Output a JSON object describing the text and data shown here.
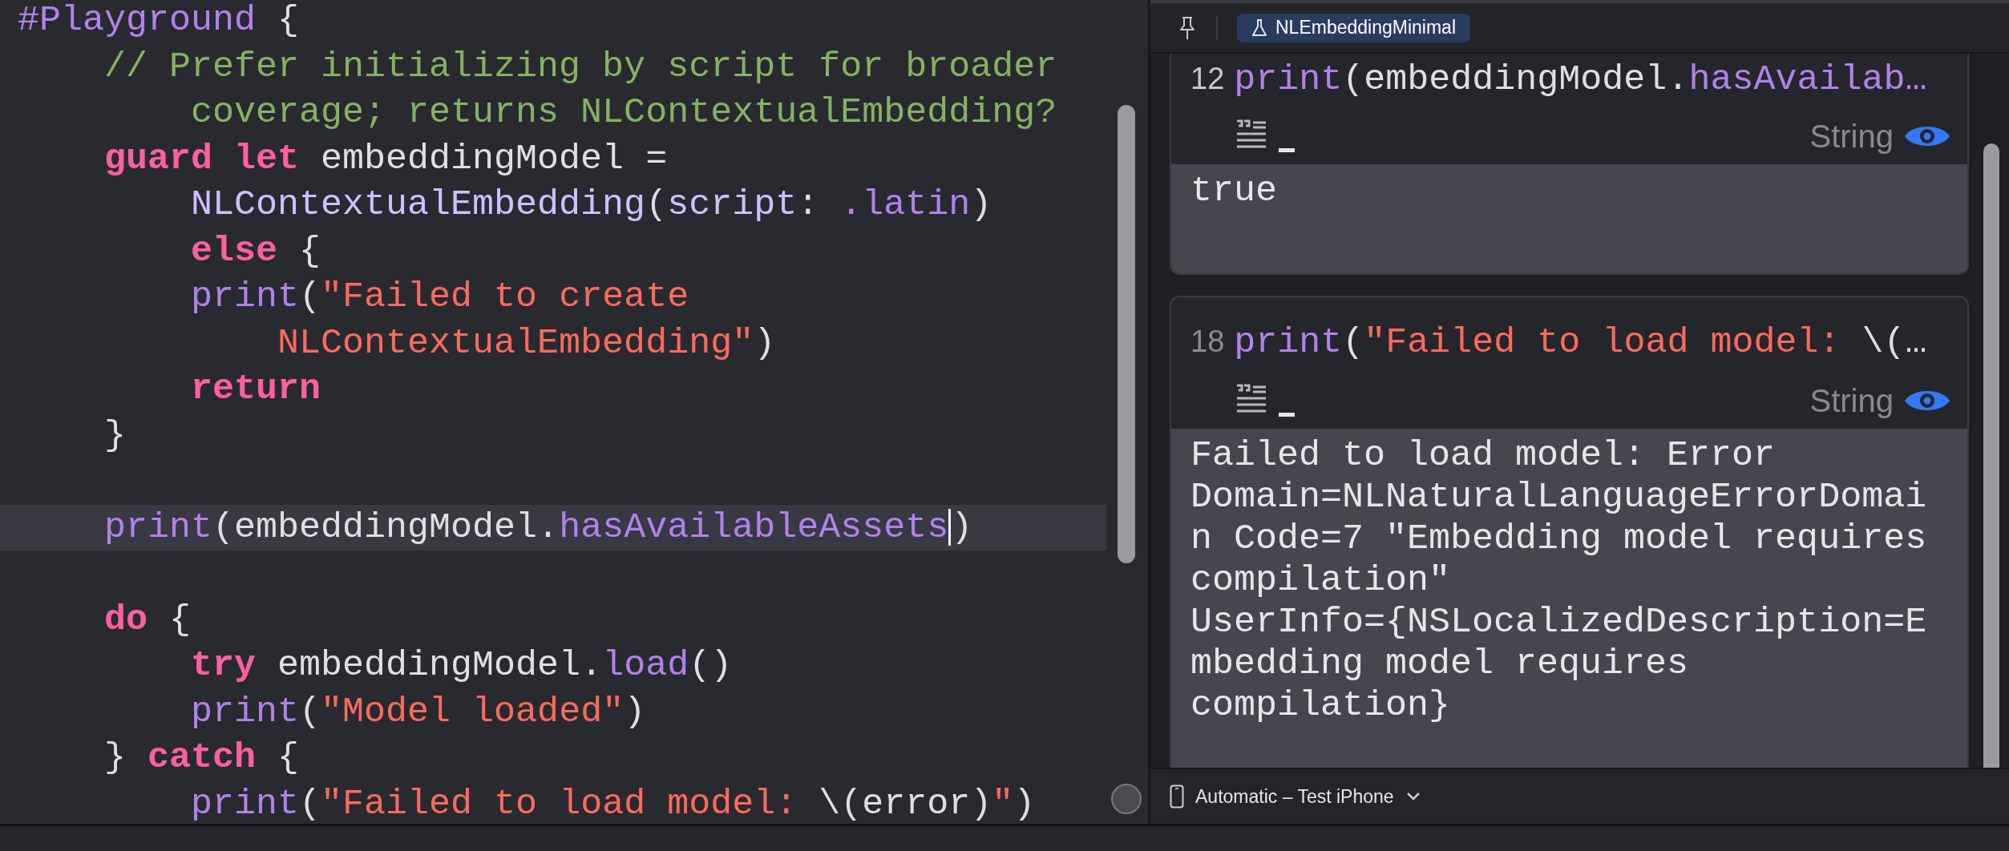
{
  "editor": {
    "lines": [
      {
        "current": false,
        "tokens": [
          {
            "kind": "macro",
            "text": "#Playground"
          },
          {
            "kind": "plain",
            "text": " {"
          }
        ]
      },
      {
        "current": false,
        "tokens": [
          {
            "kind": "comment",
            "text": "    // Prefer initializing by script for broader"
          }
        ]
      },
      {
        "current": false,
        "tokens": [
          {
            "kind": "comment",
            "text": "        coverage; returns NLContextualEmbedding?"
          }
        ]
      },
      {
        "current": false,
        "tokens": [
          {
            "kind": "keyword",
            "text": "    guard let"
          },
          {
            "kind": "plain",
            "text": " embeddingModel ="
          }
        ]
      },
      {
        "current": false,
        "tokens": [
          {
            "kind": "type",
            "text": "        NLContextualEmbedding"
          },
          {
            "kind": "plain",
            "text": "("
          },
          {
            "kind": "type",
            "text": "script"
          },
          {
            "kind": "plain",
            "text": ": "
          },
          {
            "kind": "member",
            "text": ".latin"
          },
          {
            "kind": "plain",
            "text": ")"
          }
        ]
      },
      {
        "current": false,
        "tokens": [
          {
            "kind": "keyword",
            "text": "        else"
          },
          {
            "kind": "plain",
            "text": " {"
          }
        ]
      },
      {
        "current": false,
        "tokens": [
          {
            "kind": "member",
            "text": "        print"
          },
          {
            "kind": "plain",
            "text": "("
          },
          {
            "kind": "string",
            "text": "\"Failed to create"
          }
        ]
      },
      {
        "current": false,
        "tokens": [
          {
            "kind": "string",
            "text": "            NLContextualEmbedding\""
          },
          {
            "kind": "plain",
            "text": ")"
          }
        ]
      },
      {
        "current": false,
        "tokens": [
          {
            "kind": "keyword",
            "text": "        return"
          }
        ]
      },
      {
        "current": false,
        "tokens": [
          {
            "kind": "plain",
            "text": "    }"
          }
        ]
      },
      {
        "current": false
      },
      {
        "current": true,
        "tokens": [
          {
            "kind": "member",
            "text": "    print"
          },
          {
            "kind": "plain",
            "text": "(embeddingModel."
          },
          {
            "kind": "member",
            "text": "hasAvailableAssets"
          },
          {
            "kind": "cursor"
          },
          {
            "kind": "plain",
            "text": ")"
          }
        ]
      },
      {
        "current": false
      },
      {
        "current": false,
        "tokens": [
          {
            "kind": "keyword",
            "text": "    do"
          },
          {
            "kind": "plain",
            "text": " {"
          }
        ]
      },
      {
        "current": false,
        "tokens": [
          {
            "kind": "keyword",
            "text": "        try"
          },
          {
            "kind": "plain",
            "text": " embeddingModel."
          },
          {
            "kind": "member",
            "text": "load"
          },
          {
            "kind": "plain",
            "text": "()"
          }
        ]
      },
      {
        "current": false,
        "tokens": [
          {
            "kind": "member",
            "text": "        print"
          },
          {
            "kind": "plain",
            "text": "("
          },
          {
            "kind": "string",
            "text": "\"Model loaded\""
          },
          {
            "kind": "plain",
            "text": ")"
          }
        ]
      },
      {
        "current": false,
        "tokens": [
          {
            "kind": "plain",
            "text": "    } "
          },
          {
            "kind": "keyword",
            "text": "catch"
          },
          {
            "kind": "plain",
            "text": " {"
          }
        ]
      },
      {
        "current": false,
        "tokens": [
          {
            "kind": "member",
            "text": "        print"
          },
          {
            "kind": "plain",
            "text": "("
          },
          {
            "kind": "string",
            "text": "\"Failed to load model: "
          },
          {
            "kind": "plain",
            "text": "\\(error)"
          },
          {
            "kind": "string",
            "text": "\""
          },
          {
            "kind": "plain",
            "text": ")"
          }
        ]
      }
    ]
  },
  "tab": {
    "label": "NLEmbeddingMinimal",
    "selected": true
  },
  "results": [
    {
      "line_number": "12",
      "tokens": [
        {
          "kind": "member",
          "text": "print"
        },
        {
          "kind": "plain",
          "text": "(embeddingModel."
        },
        {
          "kind": "member",
          "text": "hasAvailab…"
        }
      ],
      "type_label": "String",
      "result": "true"
    },
    {
      "line_number": "18",
      "tokens": [
        {
          "kind": "member",
          "text": "print"
        },
        {
          "kind": "plain",
          "text": "("
        },
        {
          "kind": "string",
          "text": "\"Failed to load model: "
        },
        {
          "kind": "plain",
          "text": "\\(…"
        }
      ],
      "type_label": "String",
      "result": "Failed to load model: Error Domain=NLNaturalLanguageErrorDomain Code=7 \"Embedding model requires compilation\" UserInfo={NSLocalizedDescription=Embedding model requires compilation}"
    }
  ],
  "device": {
    "label": "Automatic – Test iPhone"
  }
}
